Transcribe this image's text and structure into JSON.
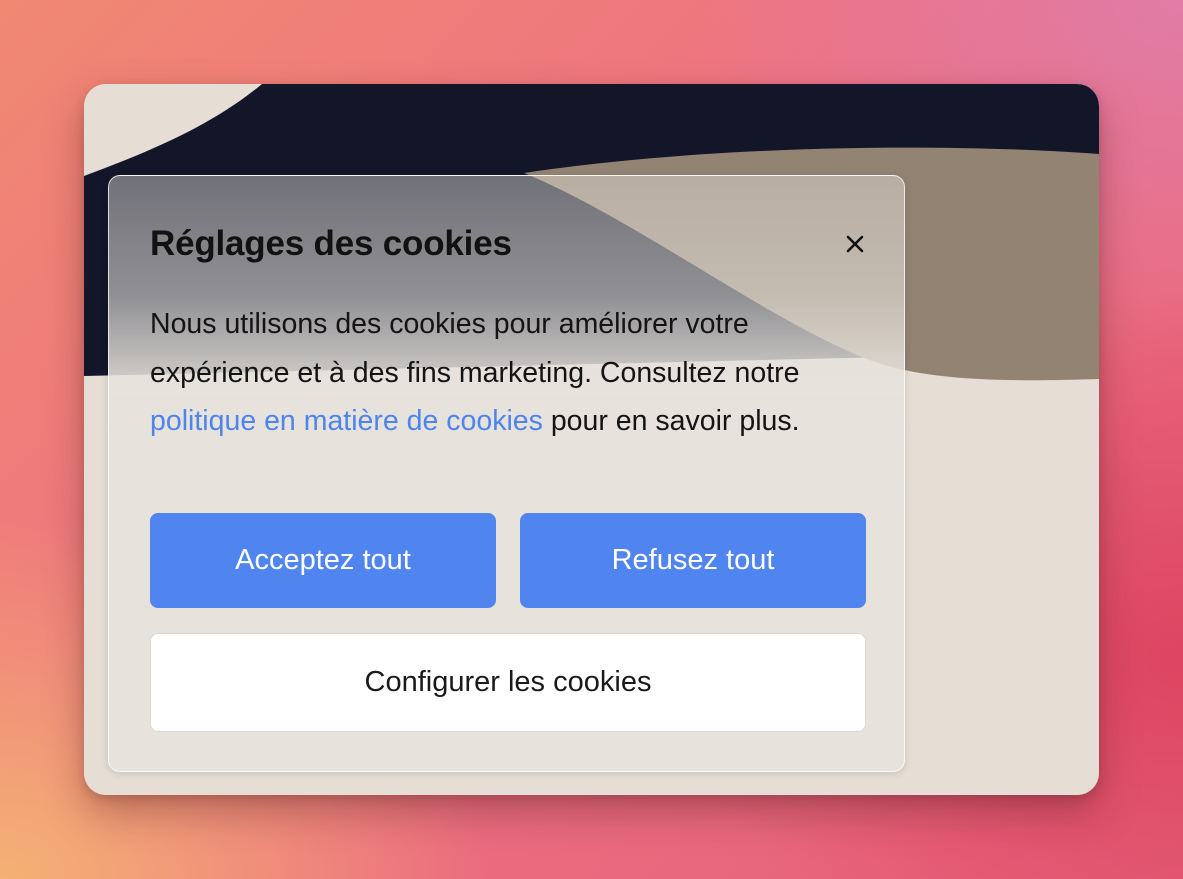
{
  "cookie_dialog": {
    "title": "Réglages des cookies",
    "close_icon": "close-icon",
    "body_before_link": "Nous utilisons des cookies pour améliorer votre expérience et à des fins marketing. Consultez notre ",
    "policy_link": "politique en matière de cookies",
    "body_after_link": " pour en savoir plus.",
    "accept_label": "Acceptez tout",
    "refuse_label": "Refusez tout",
    "configure_label": "Configurer les cookies"
  },
  "colors": {
    "primary_button": "#5084ee",
    "link": "#4e84ee",
    "dark_band": "#121628",
    "taupe_shape": "#938372",
    "cream_background": "#e6ddd4"
  }
}
